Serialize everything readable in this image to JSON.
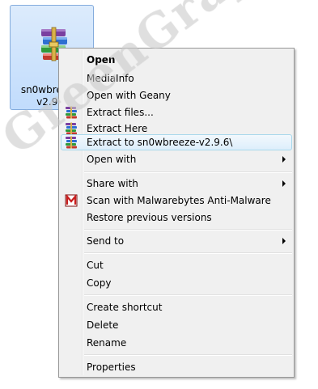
{
  "file": {
    "label": "sn0wbreeze-v2.9.6",
    "icon": "winrar-archive-icon"
  },
  "watermark": "GreenGraphics.com",
  "menu": {
    "items": [
      {
        "label": "Open",
        "bold": true
      },
      {
        "label": "MediaInfo"
      },
      {
        "label": "Open with Geany"
      },
      {
        "label": "Extract files...",
        "icon": "winrar-icon"
      },
      {
        "label": "Extract Here",
        "icon": "winrar-icon"
      },
      {
        "label": "Extract to sn0wbreeze-v2.9.6\\",
        "icon": "winrar-icon",
        "highlighted": true
      },
      {
        "label": "Open with",
        "submenu": true
      },
      {
        "label": "Share with",
        "submenu": true
      },
      {
        "label": "Scan with Malwarebytes Anti-Malware",
        "icon": "malwarebytes-icon"
      },
      {
        "label": "Restore previous versions"
      },
      {
        "label": "Send to",
        "submenu": true
      },
      {
        "label": "Cut"
      },
      {
        "label": "Copy"
      },
      {
        "label": "Create shortcut"
      },
      {
        "label": "Delete"
      },
      {
        "label": "Rename"
      },
      {
        "label": "Properties"
      }
    ]
  }
}
